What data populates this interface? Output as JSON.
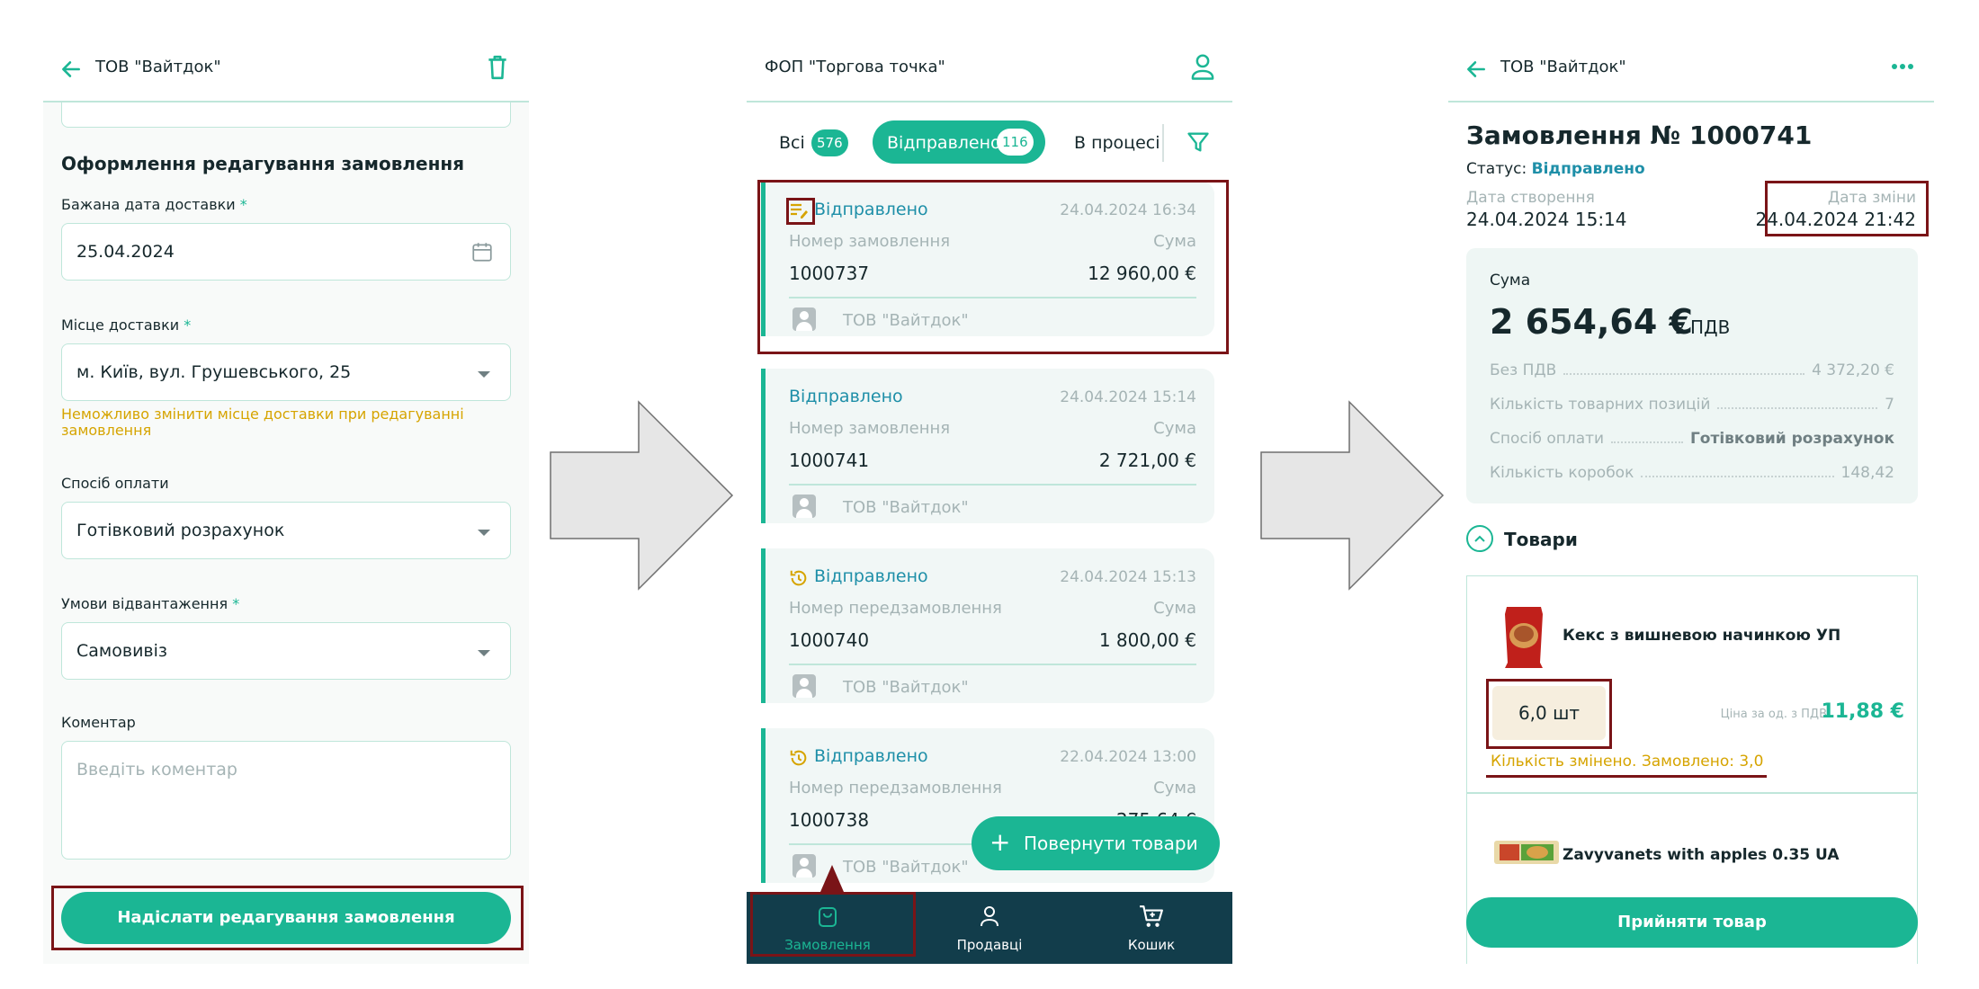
{
  "screen1": {
    "header_title": "ТОВ \"Вайтдок\"",
    "section_title": "Оформлення редагування замовлення",
    "delivery_date_label": "Бажана дата доставки",
    "delivery_date_value": "25.04.2024",
    "place_label": "Місце доставки",
    "place_value": "м. Київ, вул. Грушевського, 25",
    "place_warning": "Неможливо змінити місце доставки при редагуванні замовлення",
    "payment_label": "Спосіб оплати",
    "payment_value": "Готівковий розрахунок",
    "shipping_label": "Умови відвантаження",
    "shipping_value": "Самовивіз",
    "comment_label": "Коментар",
    "comment_placeholder": "Введіть коментар",
    "submit_button": "Надіслати редагування замовлення",
    "required_mark": "*"
  },
  "screen2": {
    "header_title": "ФОП \"Торгова точка\"",
    "tabs": [
      {
        "label": "Всі",
        "count": "576"
      },
      {
        "label": "Відправлено",
        "count": "116"
      },
      {
        "label": "В процесі",
        "count": ""
      }
    ],
    "orders": [
      {
        "status": "Відправлено",
        "date": "24.04.2024 16:34",
        "num_label": "Номер замовлення",
        "sum_label": "Сума",
        "number": "1000737",
        "sum": "12 960,00 €",
        "seller": "ТОВ \"Вайтдок\"",
        "icon": "edit-note-icon"
      },
      {
        "status": "Відправлено",
        "date": "24.04.2024 15:14",
        "num_label": "Номер замовлення",
        "sum_label": "Сума",
        "number": "1000741",
        "sum": "2 721,00 €",
        "seller": "ТОВ \"Вайтдок\"",
        "icon": ""
      },
      {
        "status": "Відправлено",
        "date": "24.04.2024 15:13",
        "num_label": "Номер передзамовлення",
        "sum_label": "Сума",
        "number": "1000740",
        "sum": "1 800,00 €",
        "seller": "ТОВ \"Вайтдок\"",
        "icon": "history-icon"
      },
      {
        "status": "Відправлено",
        "date": "22.04.2024 13:00",
        "num_label": "Номер передзамовлення",
        "sum_label": "Сума",
        "number": "1000738",
        "sum": "275,64 €",
        "seller": "ТОВ \"Вайтдок\"",
        "icon": "history-icon"
      }
    ],
    "fab_label": "Повернути товари",
    "nav": [
      {
        "label": "Замовлення",
        "icon": "bag-icon"
      },
      {
        "label": "Продавці",
        "icon": "person-icon"
      },
      {
        "label": "Кошик",
        "icon": "cart-icon"
      }
    ]
  },
  "screen3": {
    "header_title": "ТОВ \"Вайтдок\"",
    "order_title": "Замовлення № 1000741",
    "status_label": "Статус:",
    "status_value": "Відправлено",
    "created_label": "Дата створення",
    "created_value": "24.04.2024 15:14",
    "changed_label": "Дата зміни",
    "changed_value": "24.04.2024 21:42",
    "sum_label": "Сума",
    "sum_value": "2 654,64 €",
    "sum_vat": "з ПДВ",
    "rows": [
      {
        "label": "Без ПДВ",
        "value": "4 372,20 €"
      },
      {
        "label": "Кількість товарних позицій",
        "value": "7"
      },
      {
        "label": "Спосіб оплати",
        "value": "Готівковий розрахунок"
      },
      {
        "label": "Кількість коробок",
        "value": "148,42"
      }
    ],
    "goods_title": "Товари",
    "product1_name": "Кекс з вишневою начинкою УП",
    "product1_qty": "6,0 шт",
    "product1_price_label": "Ціна за од. з ПДВ",
    "product1_price": "11,88 €",
    "product1_change": "Кількість змінено. Замовлено: 3,0",
    "product2_name": "Zavyvanets with apples 0.35 UA",
    "accept_button": "Прийняти товар"
  },
  "colors": {
    "accent": "#1bb694",
    "dark_nav": "#123d4b",
    "highlight": "#7a1417",
    "warning": "#d6a400",
    "link": "#1e8fa8"
  }
}
